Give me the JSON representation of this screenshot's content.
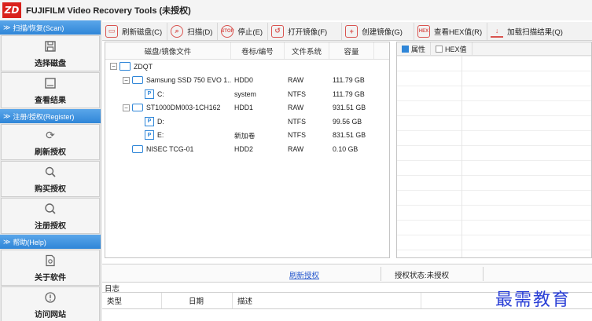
{
  "app": {
    "logo_text": "ZD",
    "title": "FUJIFILM Video Recovery Tools (未授权)"
  },
  "sidebar": {
    "sections": [
      {
        "label": "扫描/恢复(Scan)",
        "items": [
          {
            "label": "选择磁盘",
            "icon": "disk-save-icon"
          },
          {
            "label": "查看结果",
            "icon": "results-icon"
          }
        ]
      },
      {
        "label": "注册/授权(Register)",
        "items": [
          {
            "label": "刷新授权",
            "icon": "refresh-icon"
          },
          {
            "label": "购买授权",
            "icon": "buy-key-icon"
          },
          {
            "label": "注册授权",
            "icon": "register-search-icon"
          }
        ]
      },
      {
        "label": "帮助(Help)",
        "items": [
          {
            "label": "关于软件",
            "icon": "about-icon"
          },
          {
            "label": "访问网站",
            "icon": "website-icon"
          }
        ]
      }
    ]
  },
  "toolbar": {
    "buttons": [
      {
        "label": "刷新磁盘(C)",
        "icon": "disk-icon"
      },
      {
        "label": "扫描(D)",
        "icon": "scan-icon"
      },
      {
        "label": "停止(E)",
        "icon": "stop-icon"
      },
      {
        "label": "打开镜像(F)",
        "icon": "open-image-icon"
      },
      {
        "label": "创建镜像(G)",
        "icon": "create-image-icon"
      },
      {
        "label": "查看HEX值(R)",
        "icon": "hex-icon"
      },
      {
        "label": "加载扫描结果(Q)",
        "icon": "load-icon"
      }
    ]
  },
  "disk_table": {
    "columns": [
      "磁盘/镜像文件",
      "卷标/编号",
      "文件系统",
      "容量"
    ],
    "rows": [
      {
        "level": 0,
        "expander": "-",
        "icon": "computer-icon",
        "name": "ZDQT",
        "label": "",
        "fs": "",
        "size": ""
      },
      {
        "level": 1,
        "expander": "-",
        "icon": "disk-icon",
        "name": "Samsung SSD 750 EVO 1...",
        "label": "HDD0",
        "fs": "RAW",
        "size": "111.79 GB"
      },
      {
        "level": 2,
        "expander": "",
        "icon": "partition-icon",
        "name": "C:",
        "label": "system",
        "fs": "NTFS",
        "size": "111.79 GB"
      },
      {
        "level": 1,
        "expander": "-",
        "icon": "disk-icon",
        "name": "ST1000DM003-1CH162",
        "label": "HDD1",
        "fs": "RAW",
        "size": "931.51 GB"
      },
      {
        "level": 2,
        "expander": "",
        "icon": "partition-icon",
        "name": "D:",
        "label": "",
        "fs": "NTFS",
        "size": "99.56 GB"
      },
      {
        "level": 2,
        "expander": "",
        "icon": "partition-icon",
        "name": "E:",
        "label": "新加卷",
        "fs": "NTFS",
        "size": "831.51 GB"
      },
      {
        "level": 1,
        "expander": "",
        "icon": "disk-icon",
        "name": "NISEC  TCG-01",
        "label": "HDD2",
        "fs": "RAW",
        "size": "0.10 GB"
      }
    ]
  },
  "properties": {
    "tabs": [
      {
        "label": "属性"
      },
      {
        "label": "HEX值"
      }
    ]
  },
  "status": {
    "refresh_link": "刷新授权",
    "auth_status": "授权状态:未授权"
  },
  "log": {
    "title": "日志",
    "columns": [
      "类型",
      "日期",
      "描述"
    ]
  },
  "watermark": "最需教育"
}
